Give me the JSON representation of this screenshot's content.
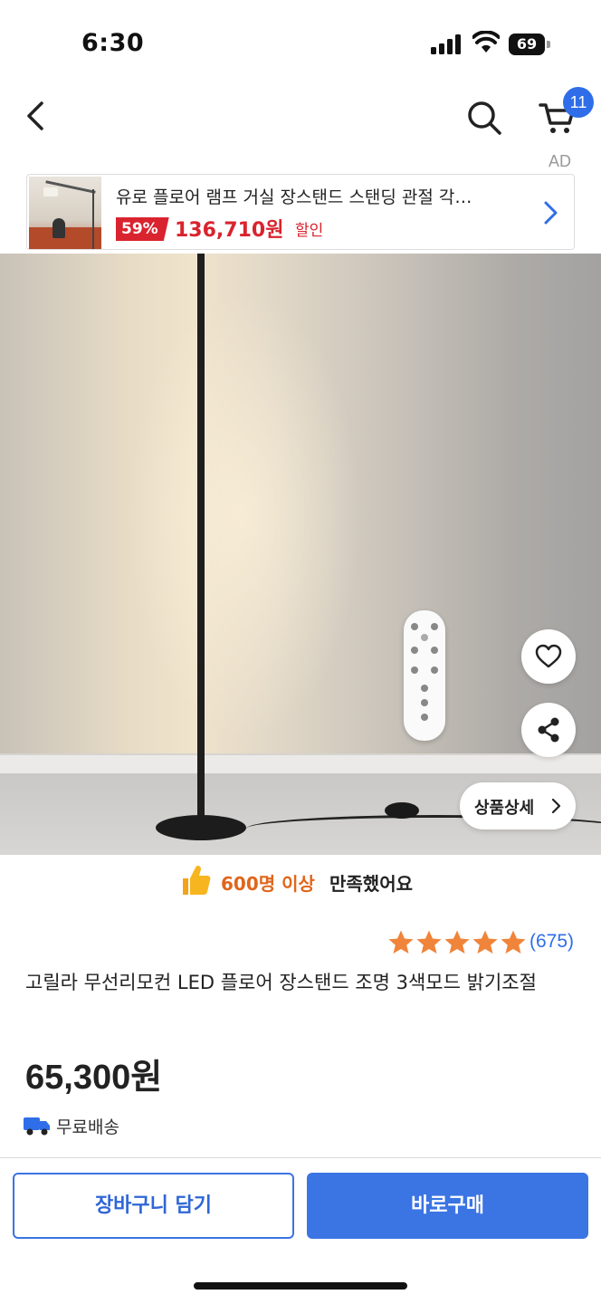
{
  "status_bar": {
    "time": "6:30",
    "battery": "69"
  },
  "header": {
    "cart_count": "11",
    "ad_label": "AD"
  },
  "ad_banner": {
    "title": "유로 플로어 램프 거실 장스탠드 스탠딩 관절 각…",
    "discount": "59%",
    "price": "136,710원",
    "sale_label": "할인"
  },
  "hero": {
    "detail_button": "상품상세"
  },
  "satisfaction": {
    "count": "600명 이상",
    "rest": "만족했어요"
  },
  "rating": {
    "stars": 5,
    "reviews": "(675)",
    "star_color": "#f0843a"
  },
  "product": {
    "title": "고릴라 무선리모컨 LED 플로어 장스탠드 조명 3색모드 밝기조절",
    "price": "65,300원",
    "shipping": "무료배송"
  },
  "actions": {
    "add_to_cart": "장바구니 담기",
    "buy_now": "바로구매"
  },
  "colors": {
    "accent": "#3b74e3",
    "sale": "#d9232e",
    "highlight": "#e0661b"
  }
}
